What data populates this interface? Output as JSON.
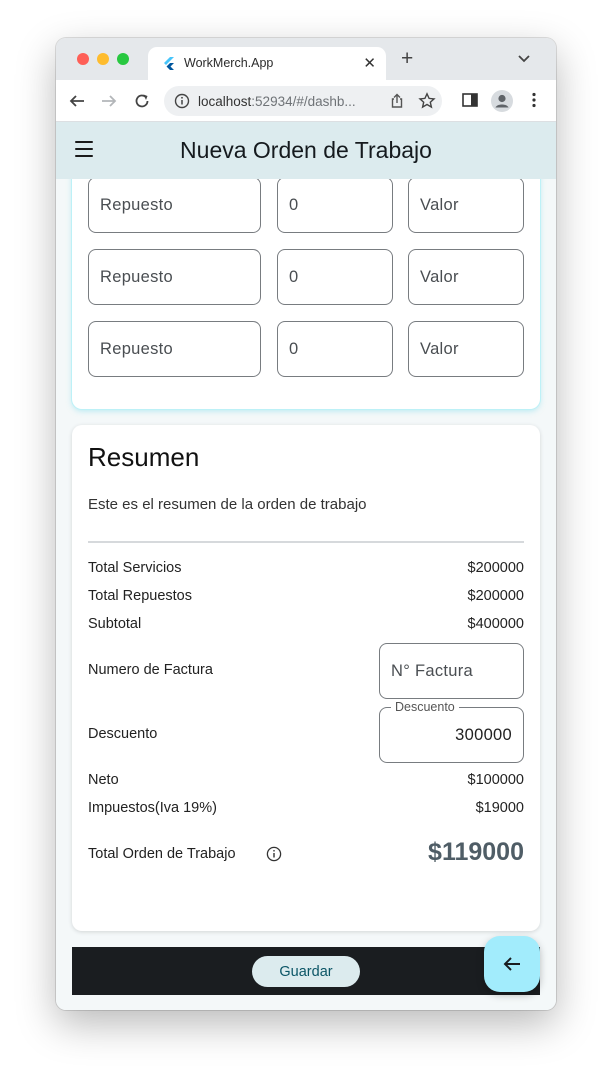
{
  "browser": {
    "tab_title": "WorkMerch.App",
    "url_host": "localhost",
    "url_rest": ":52934/#/dashb..."
  },
  "appbar": {
    "title": "Nueva Orden de Trabajo"
  },
  "parts": {
    "rows": [
      {
        "name_placeholder": "Repuesto",
        "qty": "0",
        "value_placeholder": "Valor"
      },
      {
        "name_placeholder": "Repuesto",
        "qty": "0",
        "value_placeholder": "Valor"
      },
      {
        "name_placeholder": "Repuesto",
        "qty": "0",
        "value_placeholder": "Valor"
      }
    ]
  },
  "summary": {
    "title": "Resumen",
    "description": "Este es el resumen de la orden de trabajo",
    "total_servicios_label": "Total Servicios",
    "total_servicios_value": "$200000",
    "total_repuestos_label": "Total Repuestos",
    "total_repuestos_value": "$200000",
    "subtotal_label": "Subtotal",
    "subtotal_value": "$400000",
    "factura_label": "Numero de Factura",
    "factura_placeholder": "N° Factura",
    "descuento_label": "Descuento",
    "descuento_floating_label": "Descuento",
    "descuento_value": "300000",
    "neto_label": "Neto",
    "neto_value": "$100000",
    "impuestos_label": "Impuestos(Iva 19%)",
    "impuestos_value": "$19000",
    "total_label": "Total Orden de Trabajo",
    "total_value": "$119000"
  },
  "actions": {
    "save_label": "Guardar"
  },
  "colors": {
    "appbar_bg": "#dcebee",
    "accent_cyan": "#a2ecfc",
    "bottombar_bg": "#1a1d20",
    "save_text": "#0b5566"
  }
}
